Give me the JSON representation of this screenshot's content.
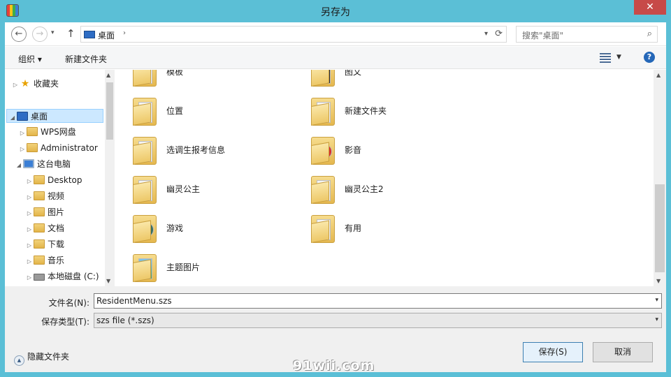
{
  "window": {
    "title": "另存为",
    "close_glyph": "✕"
  },
  "address": {
    "path_item": "桌面",
    "separator": "›",
    "search_placeholder": "搜索\"桌面\""
  },
  "toolbar": {
    "organize": "组织 ▾",
    "new_folder": "新建文件夹",
    "help": "?"
  },
  "nav_tree": [
    {
      "label": "收藏夹",
      "icon": "star-icon",
      "twisty": "▷"
    },
    {
      "label": "桌面",
      "icon": "desktop-icon",
      "twisty": "◢",
      "selected": true
    },
    {
      "label": "WPS网盘",
      "icon": "folder-icon",
      "twisty": "▷"
    },
    {
      "label": "Administrator",
      "icon": "user-folder-icon",
      "twisty": "▷"
    },
    {
      "label": "这台电脑",
      "icon": "computer-icon",
      "twisty": "◢"
    },
    {
      "label": "Desktop",
      "icon": "folder-icon",
      "twisty": "▷"
    },
    {
      "label": "视频",
      "icon": "folder-icon",
      "twisty": "▷"
    },
    {
      "label": "图片",
      "icon": "folder-icon",
      "twisty": "▷"
    },
    {
      "label": "文档",
      "icon": "folder-icon",
      "twisty": "▷"
    },
    {
      "label": "下载",
      "icon": "folder-icon",
      "twisty": "▷"
    },
    {
      "label": "音乐",
      "icon": "folder-icon",
      "twisty": "▷"
    },
    {
      "label": "本地磁盘 (C:)",
      "icon": "drive-icon",
      "twisty": "▷"
    }
  ],
  "files": [
    {
      "name": "模板",
      "icon": "folder-icon"
    },
    {
      "name": "图文",
      "icon": "folder-dark-icon"
    },
    {
      "name": "位置",
      "icon": "folder-icon"
    },
    {
      "name": "新建文件夹",
      "icon": "folder-icon"
    },
    {
      "name": "选调生报考信息",
      "icon": "folder-icon"
    },
    {
      "name": "影音",
      "icon": "folder-media-icon"
    },
    {
      "name": "幽灵公主",
      "icon": "folder-icon"
    },
    {
      "name": "幽灵公主2",
      "icon": "folder-icon"
    },
    {
      "name": "游戏",
      "icon": "folder-game-icon"
    },
    {
      "name": "有用",
      "icon": "folder-icon"
    },
    {
      "name": "主题图片",
      "icon": "folder-picture-icon"
    }
  ],
  "form": {
    "filename_label": "文件名(N):",
    "filename_value": "ResidentMenu.szs",
    "filetype_label": "保存类型(T):",
    "filetype_value": "szs file (*.szs)"
  },
  "footer": {
    "hide_folders": "隐藏文件夹",
    "save": "保存(S)",
    "cancel": "取消"
  },
  "watermark": "91wii.com"
}
